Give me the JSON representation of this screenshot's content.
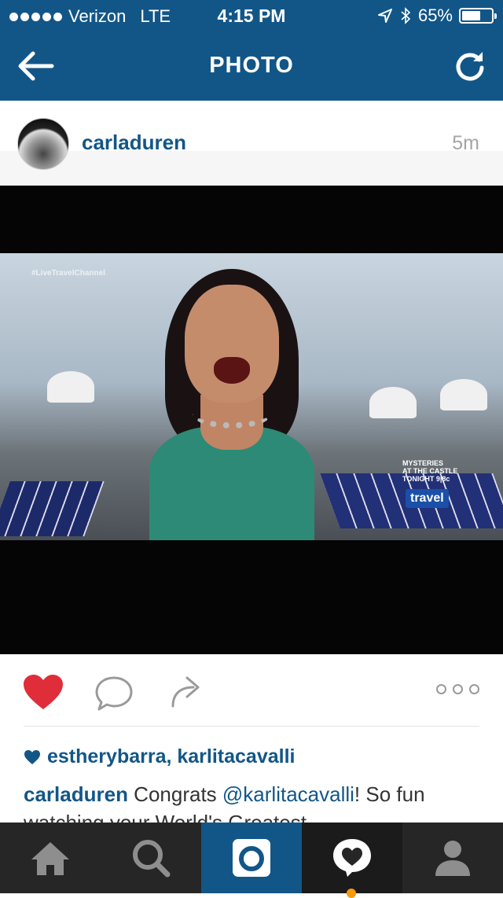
{
  "status_bar": {
    "carrier": "Verizon",
    "network": "LTE",
    "time": "4:15 PM",
    "battery": "65%",
    "battery_level": 0.65
  },
  "nav": {
    "title": "PHOTO"
  },
  "post": {
    "username": "carladuren",
    "time_ago": "5m",
    "photo": {
      "hashtag": "#LiveTravelChannel",
      "promo_line1": "MYSTERIES",
      "promo_line2": "AT THE CASTLE",
      "promo_line3": "TONIGHT 9|8c",
      "logo": "travel"
    },
    "liked": true,
    "likes_text": "estherybarra, karlitacavalli",
    "caption": {
      "user": "carladuren",
      "text_before": " Congrats ",
      "mention": "@karlitacavalli",
      "text_after": "! So fun watching your World's Greatest"
    }
  },
  "colors": {
    "brand": "#125688",
    "like_red": "#e02d3a",
    "notification": "#f79a0a"
  },
  "tabbar": {
    "icons": [
      "home-icon",
      "search-icon",
      "camera-icon",
      "news-icon",
      "profile-icon"
    ],
    "active": "camera"
  }
}
